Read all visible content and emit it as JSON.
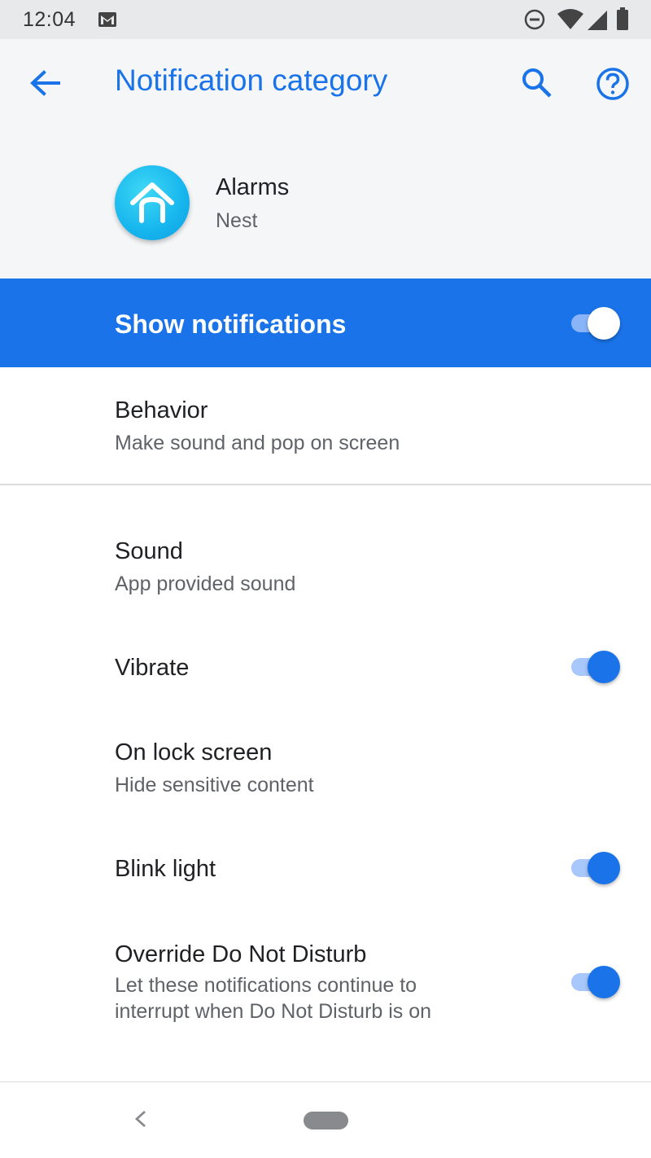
{
  "status_bar": {
    "time": "12:04",
    "icons": [
      "gmail-icon",
      "dnd-icon",
      "wifi-icon",
      "signal-icon",
      "battery-icon"
    ]
  },
  "header": {
    "title": "Notification category",
    "back_icon": "arrow-back-icon",
    "search_icon": "search-icon",
    "help_icon": "help-icon"
  },
  "app": {
    "name": "Alarms",
    "subtitle": "Nest",
    "icon": "nest-home-icon"
  },
  "master_toggle": {
    "label": "Show notifications",
    "on": true
  },
  "settings": {
    "behavior": {
      "title": "Behavior",
      "subtitle": "Make sound and pop on screen"
    },
    "sound": {
      "title": "Sound",
      "subtitle": "App provided sound"
    },
    "vibrate": {
      "title": "Vibrate",
      "on": true
    },
    "lock_screen": {
      "title": "On lock screen",
      "subtitle": "Hide sensitive content"
    },
    "blink_light": {
      "title": "Blink light",
      "on": true
    },
    "override_dnd": {
      "title": "Override Do Not Disturb",
      "subtitle_line1": "Let these notifications continue to",
      "subtitle_line2": "interrupt when Do Not Disturb is on",
      "on": true
    }
  },
  "colors": {
    "accent": "#1a73e8",
    "header_bg": "#f5f6f8",
    "status_bg": "#e8e9eb"
  },
  "nav_bar": {
    "back_icon": "nav-back-icon",
    "home_icon": "nav-home-pill-icon"
  }
}
